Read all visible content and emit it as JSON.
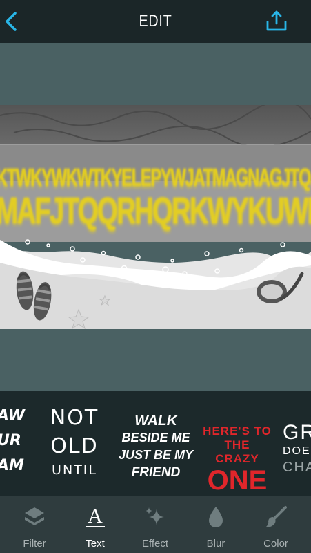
{
  "header": {
    "title": "EDIT"
  },
  "image_text": {
    "line1": "KTWKYWKWTKYELEPYWJATMAGNAGJTQJQTA",
    "line2": "MAFJTQQRHQRKWYKUWK"
  },
  "stickers": [
    {
      "lines": [
        "AW",
        "UR",
        "AM"
      ]
    },
    {
      "lines": [
        "NOT",
        "OLD",
        "UNTIL"
      ]
    },
    {
      "lines": [
        "WALK",
        "BESIDE ME",
        "JUST BE MY",
        "FRIEND"
      ]
    },
    {
      "lines": [
        "HERE'S TO",
        "THE CRAZY",
        "ONE"
      ]
    },
    {
      "lines": [
        "GR",
        "DOE",
        "CHA"
      ]
    }
  ],
  "tabs": [
    {
      "label": "Filter",
      "icon": "layers-icon"
    },
    {
      "label": "Text",
      "icon": "text-a-icon"
    },
    {
      "label": "Effect",
      "icon": "sparkle-icon"
    },
    {
      "label": "Blur",
      "icon": "drop-icon"
    },
    {
      "label": "Color",
      "icon": "brush-icon"
    }
  ],
  "active_tab": "Text",
  "colors": {
    "accent": "#29b6e8",
    "overlay_text": "#e9d21a",
    "sticker_red": "#e0262b"
  }
}
